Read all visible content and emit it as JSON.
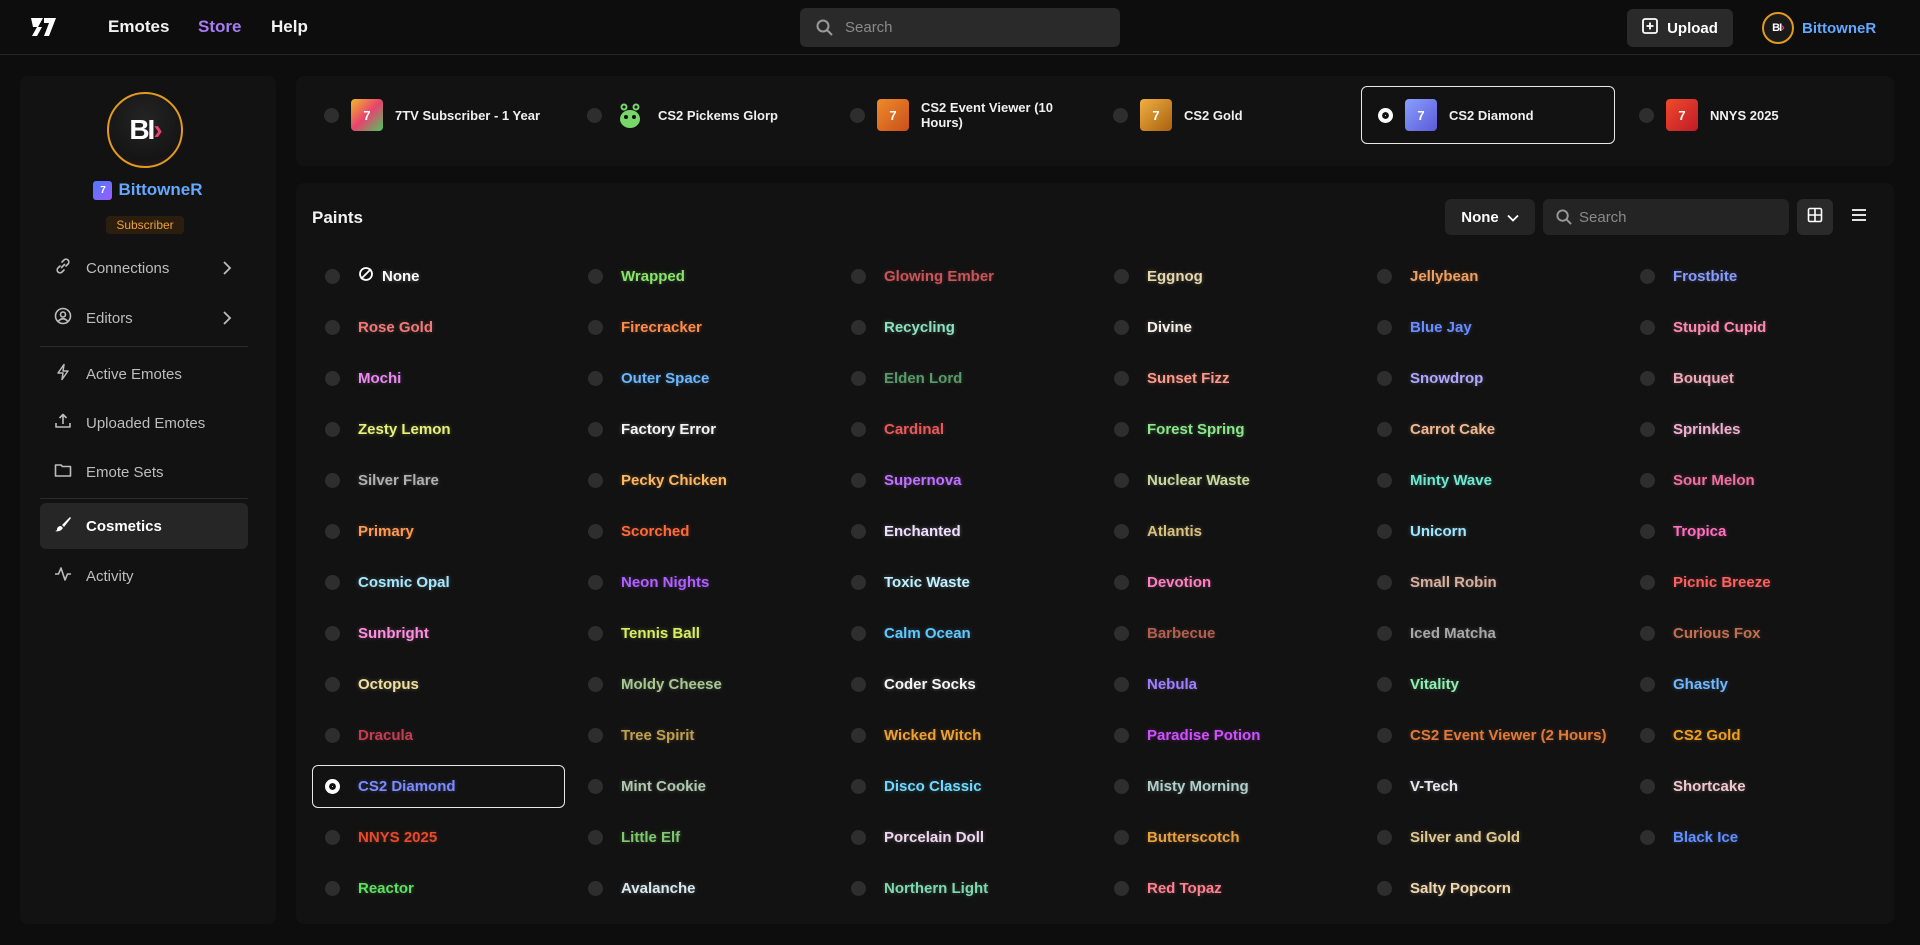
{
  "nav": {
    "links": [
      "Emotes",
      "Store",
      "Help"
    ],
    "search_placeholder": "Search",
    "upload_label": "Upload",
    "username": "BittowneR",
    "avatar_initials": "BI"
  },
  "profile": {
    "name": "BittowneR",
    "role_badge": "Subscriber",
    "tv_badge": "7tv"
  },
  "sidebar": {
    "items": [
      {
        "label": "Connections",
        "icon": "link-icon"
      },
      {
        "label": "Editors",
        "icon": "user-circle-icon"
      },
      {
        "label": "Active Emotes",
        "icon": "bolt-icon"
      },
      {
        "label": "Uploaded Emotes",
        "icon": "upload-icon"
      },
      {
        "label": "Emote Sets",
        "icon": "folder-icon"
      },
      {
        "label": "Cosmetics",
        "icon": "brush-icon"
      },
      {
        "label": "Activity",
        "icon": "activity-icon"
      }
    ]
  },
  "badges": [
    {
      "label": "7TV Subscriber - 1 Year",
      "selected": false,
      "color": "#f0b92a"
    },
    {
      "label": "CS2 Pickems Glorp",
      "selected": false,
      "color": "#78d66a"
    },
    {
      "label": "CS2 Event Viewer (10 Hours)",
      "selected": false,
      "color": "#e0742a"
    },
    {
      "label": "CS2 Gold",
      "selected": false,
      "color": "#d8952a"
    },
    {
      "label": "CS2 Diamond",
      "selected": true,
      "color": "#6b7dff"
    },
    {
      "label": "NNYS 2025",
      "selected": false,
      "color": "#e8402a"
    }
  ],
  "paints": {
    "title": "Paints",
    "filter_value": "None",
    "search_placeholder": "Search",
    "items": [
      {
        "name": "None",
        "color": "#ffffff"
      },
      {
        "name": "Wrapped",
        "color": "#8be36b"
      },
      {
        "name": "Glowing Ember",
        "color": "#c8555a"
      },
      {
        "name": "Eggnog",
        "color": "#e8d8b0"
      },
      {
        "name": "Jellybean",
        "color": "#f0a060"
      },
      {
        "name": "Frostbite",
        "color": "#8a9bff"
      },
      {
        "name": "Rose Gold",
        "color": "#f07a7a"
      },
      {
        "name": "Firecracker",
        "color": "#ff8c4a"
      },
      {
        "name": "Recycling",
        "color": "#8ee0c0"
      },
      {
        "name": "Divine",
        "color": "#f5f0e8"
      },
      {
        "name": "Blue Jay",
        "color": "#6a8cff"
      },
      {
        "name": "Stupid Cupid",
        "color": "#ff8ab0"
      },
      {
        "name": "Mochi",
        "color": "#e88af0"
      },
      {
        "name": "Outer Space",
        "color": "#6ab8ff"
      },
      {
        "name": "Elden Lord",
        "color": "#5a9a6a"
      },
      {
        "name": "Sunset Fizz",
        "color": "#ff9a8a"
      },
      {
        "name": "Snowdrop",
        "color": "#b0a8ff"
      },
      {
        "name": "Bouquet",
        "color": "#f0a8b8"
      },
      {
        "name": "Zesty Lemon",
        "color": "#e8f078"
      },
      {
        "name": "Factory Error",
        "color": "#f5f5f5"
      },
      {
        "name": "Cardinal",
        "color": "#e85a5a"
      },
      {
        "name": "Forest Spring",
        "color": "#8ae88a"
      },
      {
        "name": "Carrot Cake",
        "color": "#f0b890"
      },
      {
        "name": "Sprinkles",
        "color": "#f0b0d0"
      },
      {
        "name": "Silver Flare",
        "color": "#b0b0b0"
      },
      {
        "name": "Pecky Chicken",
        "color": "#ffb860"
      },
      {
        "name": "Supernova",
        "color": "#c070ff"
      },
      {
        "name": "Nuclear Waste",
        "color": "#c8d8a0"
      },
      {
        "name": "Minty Wave",
        "color": "#70e8d0"
      },
      {
        "name": "Sour Melon",
        "color": "#f070a0"
      },
      {
        "name": "Primary",
        "color": "#ff9a50"
      },
      {
        "name": "Scorched",
        "color": "#ff6a3a"
      },
      {
        "name": "Enchanted",
        "color": "#f0e0ff"
      },
      {
        "name": "Atlantis",
        "color": "#d8c080"
      },
      {
        "name": "Unicorn",
        "color": "#a0e8ff"
      },
      {
        "name": "Tropica",
        "color": "#ff70c0"
      },
      {
        "name": "Cosmic Opal",
        "color": "#a8e8ff"
      },
      {
        "name": "Neon Nights",
        "color": "#b060ff"
      },
      {
        "name": "Toxic Waste",
        "color": "#c0f0ff"
      },
      {
        "name": "Devotion",
        "color": "#ff80c0"
      },
      {
        "name": "Small Robin",
        "color": "#d8b0a0"
      },
      {
        "name": "Picnic Breeze",
        "color": "#ff6060"
      },
      {
        "name": "Sunbright",
        "color": "#ff90e0"
      },
      {
        "name": "Tennis Ball",
        "color": "#d8f060"
      },
      {
        "name": "Calm Ocean",
        "color": "#60c8ff"
      },
      {
        "name": "Barbecue",
        "color": "#b06050"
      },
      {
        "name": "Iced Matcha",
        "color": "#a8a8a8"
      },
      {
        "name": "Curious Fox",
        "color": "#c07050"
      },
      {
        "name": "Octopus",
        "color": "#f0e0a0"
      },
      {
        "name": "Moldy Cheese",
        "color": "#a8c890"
      },
      {
        "name": "Coder Socks",
        "color": "#f5f5f5"
      },
      {
        "name": "Nebula",
        "color": "#a080ff"
      },
      {
        "name": "Vitality",
        "color": "#90f0b0"
      },
      {
        "name": "Ghastly",
        "color": "#70b8ff"
      },
      {
        "name": "Dracula",
        "color": "#c04050"
      },
      {
        "name": "Tree Spirit",
        "color": "#c0a050"
      },
      {
        "name": "Wicked Witch",
        "color": "#f0a030"
      },
      {
        "name": "Paradise Potion",
        "color": "#d050ff"
      },
      {
        "name": "CS2 Event Viewer (2 Hours)",
        "color": "#e07a3a"
      },
      {
        "name": "CS2 Gold",
        "color": "#f0a020"
      },
      {
        "name": "CS2 Diamond",
        "color": "#7a8cff"
      },
      {
        "name": "Mint Cookie",
        "color": "#b0c8b0"
      },
      {
        "name": "Disco Classic",
        "color": "#70d8ff"
      },
      {
        "name": "Misty Morning",
        "color": "#b0d0c8"
      },
      {
        "name": "V-Tech",
        "color": "#e8e8f0"
      },
      {
        "name": "Shortcake",
        "color": "#f0c8d0"
      },
      {
        "name": "NNYS 2025",
        "color": "#e84a2a"
      },
      {
        "name": "Little Elf",
        "color": "#80c870"
      },
      {
        "name": "Porcelain Doll",
        "color": "#f0d8f0"
      },
      {
        "name": "Butterscotch",
        "color": "#e8a040"
      },
      {
        "name": "Silver and Gold",
        "color": "#e0c890"
      },
      {
        "name": "Black Ice",
        "color": "#6090ff"
      },
      {
        "name": "Reactor",
        "color": "#60e060"
      },
      {
        "name": "Avalanche",
        "color": "#d8e8f0"
      },
      {
        "name": "Northern Light",
        "color": "#80d8b0"
      },
      {
        "name": "Red Topaz",
        "color": "#ff8090"
      },
      {
        "name": "Salty Popcorn",
        "color": "#f0d8b0"
      }
    ]
  },
  "selected_paint": "CS2 Diamond",
  "colors": {
    "accent": "#a77bf3",
    "username": "#63a7ff",
    "avatar_ring": "#e49a1d",
    "subscriber": "#f2a03a"
  }
}
